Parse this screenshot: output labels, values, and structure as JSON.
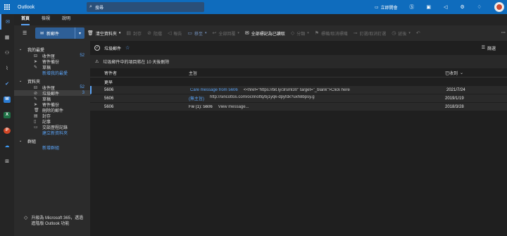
{
  "app": {
    "title": "Outlook"
  },
  "search": {
    "placeholder": "搜尋"
  },
  "top": {
    "meet_now": "立即開會"
  },
  "tabs": [
    "首頁",
    "檢視",
    "說明"
  ],
  "ribbon": {
    "new_mail": "新郵件",
    "empty_folder": "清空資料夾",
    "archive": "封存",
    "block": "阻擋",
    "report": "報告",
    "move": "移至",
    "reply_all": "全部回覆",
    "mark_all_read": "全部標記為已讀取",
    "categorize": "分類",
    "mark_unread": "標幟/取消標幟",
    "pin": "釘選/取消釘選",
    "snooze": "延後"
  },
  "folders": {
    "favorites": {
      "header": "我的最愛",
      "items": [
        {
          "icon": "inbox-icon",
          "label": "收件匣",
          "count": "52"
        },
        {
          "icon": "sent-icon",
          "label": "寄件備份",
          "count": ""
        },
        {
          "icon": "draft-icon",
          "label": "草稿",
          "count": ""
        }
      ],
      "add_link": "新增我的最愛"
    },
    "mail": {
      "header": "資料夾",
      "items": [
        {
          "icon": "inbox-icon",
          "label": "收件匣",
          "count": "52"
        },
        {
          "icon": "junk-icon",
          "label": "垃圾郵件",
          "count": "3"
        },
        {
          "icon": "draft-icon",
          "label": "草稿",
          "count": ""
        },
        {
          "icon": "sent-icon",
          "label": "寄件備份",
          "count": ""
        },
        {
          "icon": "trash-icon",
          "label": "刪除的郵件",
          "count": ""
        },
        {
          "icon": "archive-icon",
          "label": "封存",
          "count": ""
        },
        {
          "icon": "note-icon",
          "label": "記事",
          "count": ""
        },
        {
          "icon": "folder-icon",
          "label": "交談歷程記錄",
          "count": ""
        }
      ],
      "add_link": "建立新資料夾"
    },
    "groups": {
      "header": "群組",
      "add_link": "新增群組"
    },
    "upsell": "升級為 Microsoft 365，透過 進階版 Outlook 功能"
  },
  "list": {
    "folder_title": "垃圾郵件",
    "filter": "篩選",
    "notice": "垃圾郵件中的項目將在 10 天後刪除",
    "col_from": "寄件者",
    "col_subject": "主旨",
    "col_received": "已收到",
    "group_label": "更早",
    "messages": [
      {
        "from": "5606",
        "subject": "Care message from 5606",
        "preview": "<<href=\"https://bit.ly/3rsml30\" target=\"_blank\">Click here",
        "date": "2021/7/24"
      },
      {
        "from": "5606",
        "subject": "(無主旨)",
        "preview": "http://sincottos.com/ocnnotfq/bj1yqk-dpyfdx?uxh8bpsy.g",
        "date": "2019/1/19"
      },
      {
        "from": "5606",
        "subject": "Fw (1): 5606",
        "preview": "View message...",
        "date": "2018/3/28"
      }
    ]
  },
  "colors": {
    "accent": "#0f6cbd",
    "link": "#5aa2f4",
    "background": "#1f1f1f"
  }
}
